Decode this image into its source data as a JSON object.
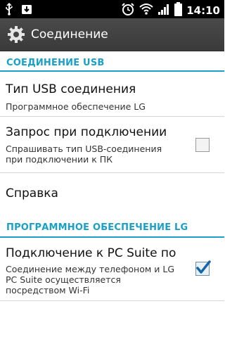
{
  "status_bar": {
    "time": "14:10",
    "icons": [
      "usb-icon",
      "download-icon",
      "alarm-icon",
      "wifi-icon",
      "signal-icon",
      "battery-icon"
    ]
  },
  "action_bar": {
    "title": "Соединение",
    "icon": "settings-gear-icon"
  },
  "sections": [
    {
      "header": "СОЕДИНЕНИЕ USB",
      "items": [
        {
          "title": "Тип USB соединения",
          "summary": [
            "Программное обеспечение LG"
          ]
        },
        {
          "title": "Запрос при подключении",
          "summary": [
            "Спрашивать тип USB-соединения",
            "при подключении к ПК"
          ],
          "checked": false
        },
        {
          "title": "Справка"
        }
      ]
    },
    {
      "header": "ПРОГРАММНОЕ ОБЕСПЕЧЕНИЕ LG",
      "items": [
        {
          "title": "Подключение к PC Suite по W",
          "summary": [
            "Соединение между телефоном и LG",
            "PC Suite осуществляется",
            "посредством Wi-Fi"
          ],
          "checked": true
        }
      ]
    }
  ],
  "colors": {
    "accent": "#19a0c8",
    "status_bar": "#000000",
    "action_bar": "#404040",
    "checkmark": "#1565a8"
  }
}
